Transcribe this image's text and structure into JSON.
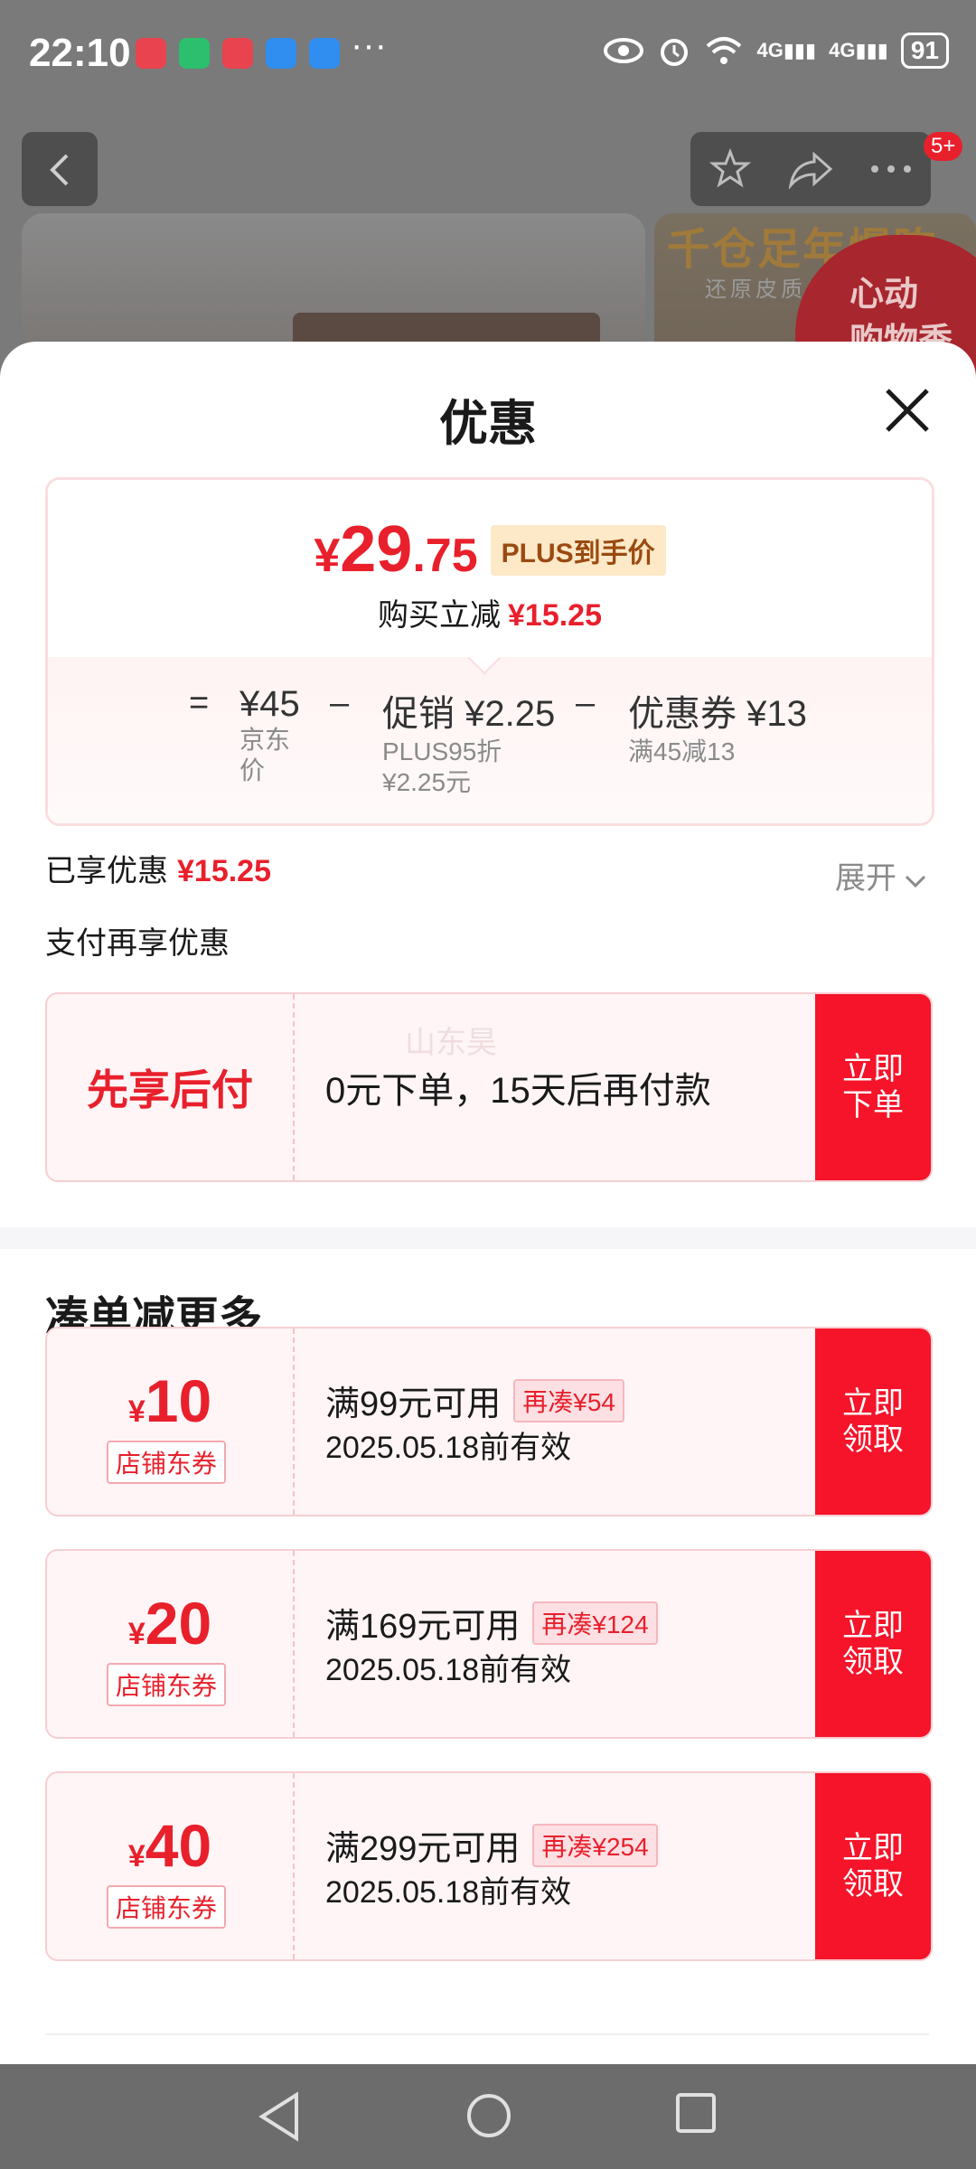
{
  "status_bar": {
    "time": "22:10",
    "more": "···",
    "net1": "4G",
    "net2": "4G",
    "battery": "91"
  },
  "background": {
    "promo_text": "千仓足年爆陈",
    "promo_sub": "还原皮质",
    "badge_text": "心动\n购物季",
    "notification_badge": "5+"
  },
  "sheet": {
    "title": "优惠"
  },
  "price": {
    "yen": "¥",
    "integer": "29",
    "decimal": ".75",
    "tag": "PLUS到手价",
    "reduce_label": "购买立减",
    "reduce_value": "¥15.25"
  },
  "calc": {
    "equals": "=",
    "minus": "–",
    "jd_price": "¥45",
    "jd_label_1": "京东",
    "jd_label_2": "价",
    "promo": "促销 ¥2.25",
    "promo_sub_1": "PLUS95折",
    "promo_sub_2": "¥2.25元",
    "coupon": "优惠券 ¥13",
    "coupon_sub": "满45减13"
  },
  "saved": {
    "label": "已享优惠",
    "value": "¥15.25",
    "expand": "展开"
  },
  "pay": {
    "label": "支付再享优惠",
    "bnpl_title": "先享后付",
    "bnpl_desc": "0元下单，15天后再付款",
    "watermark": "山东昊",
    "action": "立即\n下单"
  },
  "section": {
    "title": "凑单减更多"
  },
  "coupons": [
    {
      "yen": "¥",
      "amount": "10",
      "type": "店铺东券",
      "condition": "满99元可用",
      "more": "再凑¥54",
      "valid": "2025.05.18前有效",
      "action": "立即\n领取"
    },
    {
      "yen": "¥",
      "amount": "20",
      "type": "店铺东券",
      "condition": "满169元可用",
      "more": "再凑¥124",
      "valid": "2025.05.18前有效",
      "action": "立即\n领取"
    },
    {
      "yen": "¥",
      "amount": "40",
      "type": "店铺东券",
      "condition": "满299元可用",
      "more": "再凑¥254",
      "valid": "2025.05.18前有效",
      "action": "立即\n领取"
    }
  ],
  "colors": {
    "accent": "#e8202c",
    "action_bg": "#f5142a",
    "plus_tag_bg": "#fde9c8"
  }
}
